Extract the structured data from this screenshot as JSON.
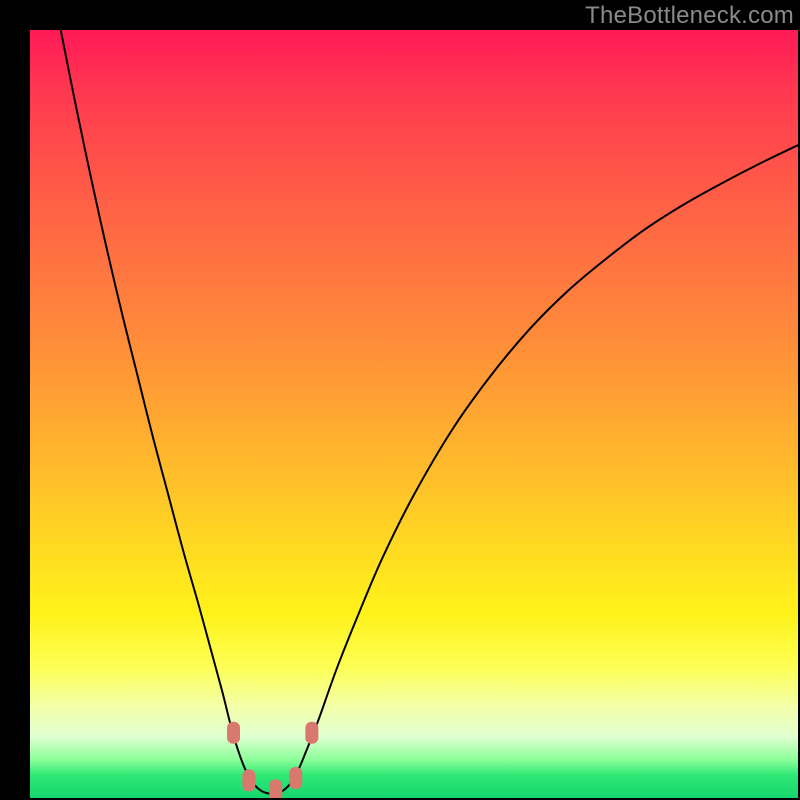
{
  "watermark": "TheBottleneck.com",
  "chart_data": {
    "type": "line",
    "title": "",
    "xlabel": "",
    "ylabel": "",
    "xlim": [
      0,
      100
    ],
    "ylim": [
      0,
      100
    ],
    "grid": false,
    "curve": [
      {
        "x": 4.0,
        "y": 100.0
      },
      {
        "x": 6.0,
        "y": 90.0
      },
      {
        "x": 8.0,
        "y": 80.5
      },
      {
        "x": 10.0,
        "y": 71.5
      },
      {
        "x": 12.0,
        "y": 63.0
      },
      {
        "x": 14.0,
        "y": 55.0
      },
      {
        "x": 16.0,
        "y": 47.0
      },
      {
        "x": 18.0,
        "y": 39.5
      },
      {
        "x": 20.0,
        "y": 32.0
      },
      {
        "x": 22.0,
        "y": 25.0
      },
      {
        "x": 23.5,
        "y": 19.5
      },
      {
        "x": 25.0,
        "y": 14.0
      },
      {
        "x": 26.0,
        "y": 10.0
      },
      {
        "x": 27.0,
        "y": 6.5
      },
      {
        "x": 28.0,
        "y": 3.8
      },
      {
        "x": 29.0,
        "y": 2.0
      },
      {
        "x": 30.0,
        "y": 1.0
      },
      {
        "x": 31.0,
        "y": 0.6
      },
      {
        "x": 32.0,
        "y": 0.6
      },
      {
        "x": 33.0,
        "y": 1.0
      },
      {
        "x": 34.0,
        "y": 2.0
      },
      {
        "x": 35.0,
        "y": 3.8
      },
      {
        "x": 36.0,
        "y": 6.2
      },
      {
        "x": 37.5,
        "y": 10.0
      },
      {
        "x": 40.0,
        "y": 17.0
      },
      {
        "x": 43.0,
        "y": 24.5
      },
      {
        "x": 46.0,
        "y": 31.5
      },
      {
        "x": 50.0,
        "y": 39.5
      },
      {
        "x": 55.0,
        "y": 48.0
      },
      {
        "x": 60.0,
        "y": 55.0
      },
      {
        "x": 65.0,
        "y": 61.0
      },
      {
        "x": 70.0,
        "y": 66.0
      },
      {
        "x": 75.0,
        "y": 70.2
      },
      {
        "x": 80.0,
        "y": 74.0
      },
      {
        "x": 85.0,
        "y": 77.2
      },
      {
        "x": 90.0,
        "y": 80.0
      },
      {
        "x": 95.0,
        "y": 82.6
      },
      {
        "x": 100.0,
        "y": 85.0
      }
    ],
    "markers": [
      {
        "x": 26.5,
        "y": 8.5
      },
      {
        "x": 28.5,
        "y": 2.3
      },
      {
        "x": 32.0,
        "y": 1.0
      },
      {
        "x": 34.6,
        "y": 2.6
      },
      {
        "x": 36.7,
        "y": 8.5
      }
    ]
  }
}
